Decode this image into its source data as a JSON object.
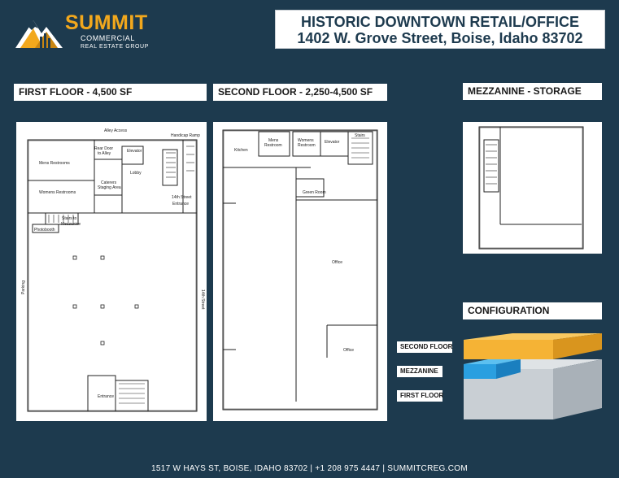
{
  "logo": {
    "wordmark": "SUMMIT",
    "line1": "COMMERCIAL",
    "line2": "REAL ESTATE GROUP",
    "icon": "mountain-logo-icon",
    "colors": {
      "gold": "#f2a81d",
      "navy": "#1d3a4e"
    }
  },
  "header": {
    "title": "HISTORIC DOWNTOWN RETAIL/OFFICE",
    "address": "1402 W. Grove Street, Boise, Idaho 83702"
  },
  "sections": {
    "first_floor": "FIRST FLOOR - 4,500 SF",
    "second_floor": "SECOND FLOOR - 2,250-4,500 SF",
    "mezzanine": "MEZZANINE - STORAGE",
    "configuration": "CONFIGURATION"
  },
  "first_floor_plan": {
    "alley_access": "Alley Access",
    "handicap_ramp": "Handicap Ramp",
    "rear_door": "Rear Door",
    "to_alley": "to Alley",
    "mens_restrooms": "Mens Restrooms",
    "womens_restrooms": "Womens Restrooms",
    "elevator": "Elevator",
    "caterers": "Caterers",
    "staging_area": "Staging Area",
    "lobby": "Lobby",
    "street_14th": "14th Street",
    "entrance": "Entrance",
    "stairs_to": "Stairs to",
    "mezzanine": "Mezzanine",
    "photobooth": "Photobooth",
    "parking": "Parking",
    "street_14th_side": "14th Street",
    "front_entrance": "Entrance"
  },
  "second_floor_plan": {
    "kitchen": "Kitchen",
    "mens": "Mens",
    "restroom": "Restroom",
    "womens": "Womens",
    "restroom2": "Restroom",
    "elevator": "Elevator",
    "stairs": "Stairs",
    "green_room": "Green Room",
    "office_upper": "Office",
    "office_lower": "Office"
  },
  "configuration": {
    "second_floor": "SECOND FLOOR",
    "mezzanine": "MEZZANINE",
    "first_floor": "FIRST FLOOR",
    "colors": {
      "second": "#f5b335",
      "mezzanine": "#2a9fe0",
      "first": "#c9cfd4"
    }
  },
  "footer": {
    "text": "1517 W HAYS ST, BOISE, IDAHO 83702  |  +1  208 975 4447  |  SUMMITCREG.COM"
  }
}
